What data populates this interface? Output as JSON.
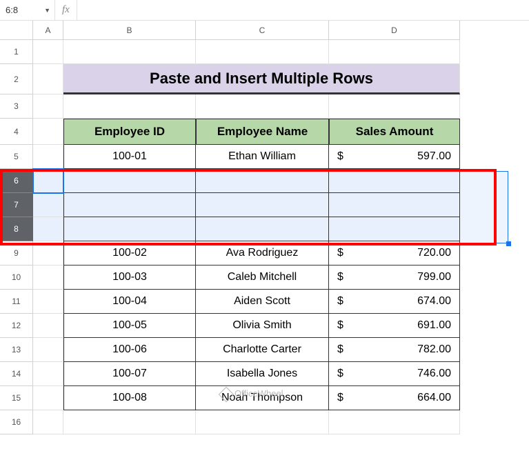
{
  "name_box": "6:8",
  "formula_bar": "",
  "fx_label": "fx",
  "columns": [
    "A",
    "B",
    "C",
    "D"
  ],
  "row_numbers": [
    "1",
    "2",
    "3",
    "4",
    "5",
    "6",
    "7",
    "8",
    "9",
    "10",
    "11",
    "12",
    "13",
    "14",
    "15",
    "16"
  ],
  "title": "Paste and Insert Multiple Rows",
  "headers": {
    "emp_id": "Employee ID",
    "emp_name": "Employee Name",
    "sales": "Sales Amount"
  },
  "data_rows": [
    {
      "row": 5,
      "id": "100-01",
      "name": "Ethan William",
      "sales": "597.00"
    },
    {
      "row": 9,
      "id": "100-02",
      "name": "Ava Rodriguez",
      "sales": "720.00"
    },
    {
      "row": 10,
      "id": "100-03",
      "name": "Caleb Mitchell",
      "sales": "799.00"
    },
    {
      "row": 11,
      "id": "100-04",
      "name": "Aiden Scott",
      "sales": "674.00"
    },
    {
      "row": 12,
      "id": "100-05",
      "name": "Olivia Smith",
      "sales": "691.00"
    },
    {
      "row": 13,
      "id": "100-06",
      "name": "Charlotte Carter",
      "sales": "782.00"
    },
    {
      "row": 14,
      "id": "100-07",
      "name": "Isabella Jones",
      "sales": "746.00"
    },
    {
      "row": 15,
      "id": "100-08",
      "name": "Noah Thompson",
      "sales": "664.00"
    }
  ],
  "currency": "$",
  "watermark": "OfficeWheel",
  "selected_rows": [
    6,
    7,
    8
  ]
}
